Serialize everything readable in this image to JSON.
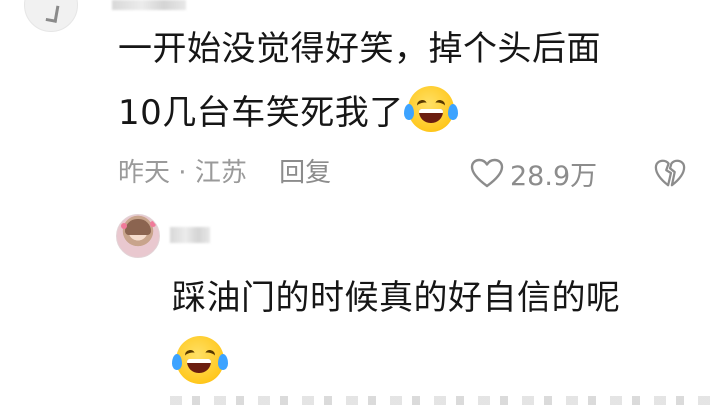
{
  "comment": {
    "line1": "一开始没觉得好笑，掉个头后面",
    "line2": "10几台车笑死我了",
    "emoji": "laughing-crying-emoji",
    "time": "昨天",
    "separator": "·",
    "location": "江苏",
    "reply_label": "回复",
    "like_count": "28.9万"
  },
  "reply": {
    "text": "踩油门的时候真的好自信的呢",
    "emoji": "laughing-crying-emoji"
  },
  "colors": {
    "text_primary": "#161616",
    "text_meta": "#9a9a9a",
    "emoji_yellow": "#ffc81e",
    "tear_blue": "#3da3ff"
  }
}
